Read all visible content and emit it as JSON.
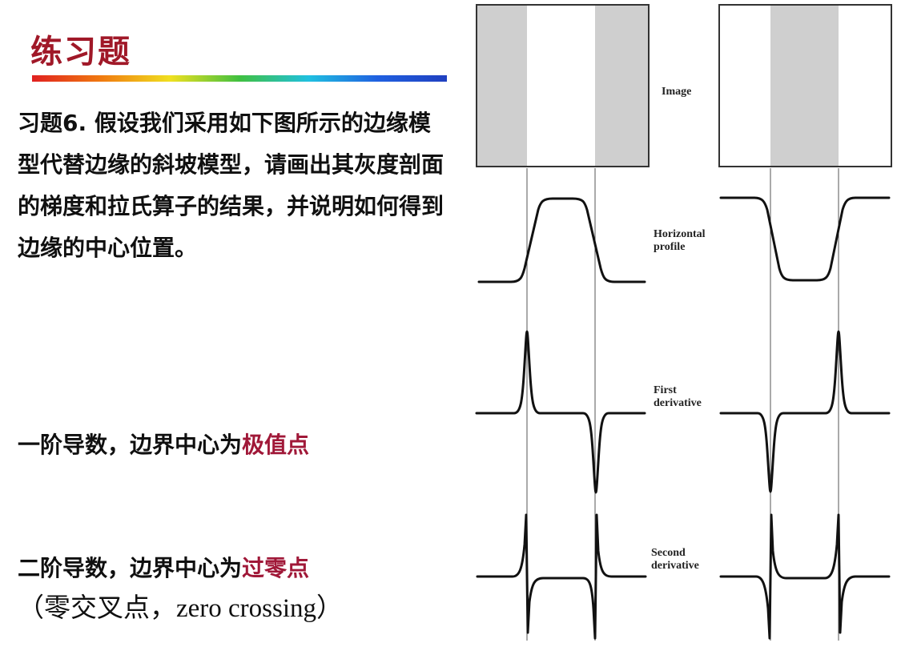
{
  "title": "练习题",
  "question": "习题6. 假设我们采用如下图所示的边缘模型代替边缘的斜坡模型，请画出其灰度剖面的梯度和拉氏算子的结果，并说明如何得到边缘的中心位置。",
  "first": {
    "prefix": "一阶导数，边界中心为",
    "highlight": "极值点"
  },
  "second": {
    "prefix": "二阶导数，边界中心为",
    "highlight": "过零点"
  },
  "note": "（零交叉点，zero crossing）",
  "diagram_labels": {
    "image": "Image",
    "horizontal_1": "Horizontal",
    "horizontal_2": "profile",
    "first_1": "First",
    "first_2": "derivative",
    "second_1": "Second",
    "second_2": "derivative"
  },
  "colors": {
    "title": "#a01828",
    "highlight": "#a01838",
    "stripe": "#cfcfcf"
  }
}
